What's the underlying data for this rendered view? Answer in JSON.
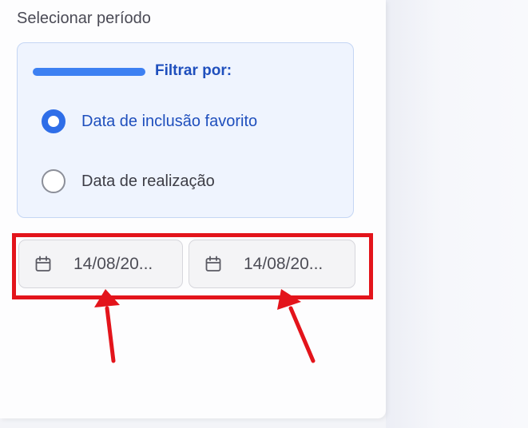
{
  "period": {
    "title": "Selecionar período"
  },
  "filter": {
    "label": "Filtrar por:",
    "options": [
      {
        "label": "Data de inclusão favorito",
        "selected": true
      },
      {
        "label": "Data de realização",
        "selected": false
      }
    ]
  },
  "dates": {
    "start": {
      "value": "14/08/20...",
      "icon": "calendar-icon"
    },
    "end": {
      "value": "14/08/20...",
      "icon": "calendar-icon"
    }
  },
  "colors": {
    "accent": "#2f6ee8",
    "active_text": "#1f4fbd",
    "card_bg": "#eff4fe",
    "annotation_red": "#e3141b"
  }
}
